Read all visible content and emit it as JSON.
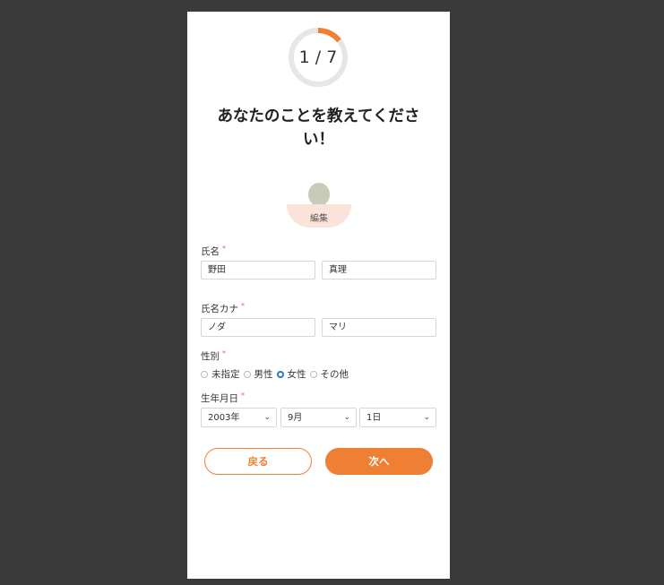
{
  "progress": {
    "current": 1,
    "total": 7,
    "label": "1 / 7",
    "fraction": 0.143,
    "color": "#ef7f33",
    "track_color": "#e6e6e6"
  },
  "title": "あなたのことを教えてください！",
  "avatar": {
    "edit_label": "編集"
  },
  "name": {
    "label": "氏名",
    "required_mark": "*",
    "last": "野田",
    "first": "真理"
  },
  "kana": {
    "label": "氏名カナ",
    "required_mark": "*",
    "last": "ノダ",
    "first": "マリ"
  },
  "gender": {
    "label": "性別",
    "required_mark": "*",
    "options": [
      "未指定",
      "男性",
      "女性",
      "その他"
    ],
    "selected": "女性"
  },
  "birthdate": {
    "label": "生年月日",
    "required_mark": "*",
    "year": "2003年",
    "month": "9月",
    "day": "1日"
  },
  "buttons": {
    "back": "戻る",
    "next": "次へ"
  },
  "colors": {
    "accent": "#ef7f33",
    "radio_selected": "#2b7bbf",
    "background": "#3a3a3a"
  }
}
